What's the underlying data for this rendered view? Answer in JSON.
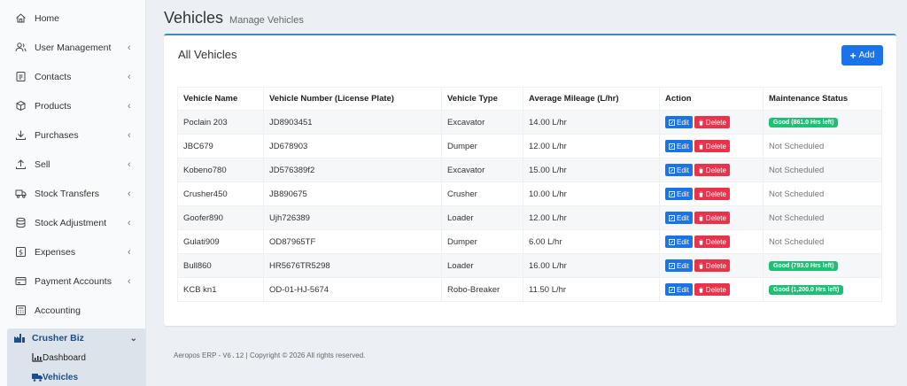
{
  "sidebar": {
    "items": [
      {
        "label": "Home",
        "icon": "home-icon",
        "chevron": false
      },
      {
        "label": "User Management",
        "icon": "users-icon",
        "chevron": true
      },
      {
        "label": "Contacts",
        "icon": "contacts-icon",
        "chevron": true
      },
      {
        "label": "Products",
        "icon": "box-icon",
        "chevron": true
      },
      {
        "label": "Purchases",
        "icon": "download-icon",
        "chevron": true
      },
      {
        "label": "Sell",
        "icon": "upload-icon",
        "chevron": true
      },
      {
        "label": "Stock Transfers",
        "icon": "truck-icon",
        "chevron": true
      },
      {
        "label": "Stock Adjustment",
        "icon": "database-icon",
        "chevron": true
      },
      {
        "label": "Expenses",
        "icon": "dollar-icon",
        "chevron": true
      },
      {
        "label": "Payment Accounts",
        "icon": "card-icon",
        "chevron": true
      },
      {
        "label": "Accounting",
        "icon": "calculator-icon",
        "chevron": false
      }
    ],
    "group": {
      "label": "Crusher Biz",
      "subitems": [
        "Dashboard",
        "Vehicles"
      ]
    }
  },
  "header": {
    "title": "Vehicles",
    "subtitle": "Manage Vehicles"
  },
  "card": {
    "title": "All Vehicles",
    "add_label": "Add"
  },
  "table": {
    "columns": [
      "Vehicle Name",
      "Vehicle Number (License Plate)",
      "Vehicle Type",
      "Average Mileage (L/hr)",
      "Action",
      "Maintenance Status"
    ],
    "edit_label": "Edit",
    "delete_label": "Delete",
    "rows": [
      {
        "name": "Poclain 203",
        "number": "JD8903451",
        "type": "Excavator",
        "mileage": "14.00 L/hr",
        "status": "Good (861.0 Hrs left)",
        "good": true
      },
      {
        "name": "JBC679",
        "number": "JD678903",
        "type": "Dumper",
        "mileage": "12.00 L/hr",
        "status": "Not Scheduled",
        "good": false
      },
      {
        "name": "Kobeno780",
        "number": "JD576389f2",
        "type": "Excavator",
        "mileage": "15.00 L/hr",
        "status": "Not Scheduled",
        "good": false
      },
      {
        "name": "Crusher450",
        "number": "JB890675",
        "type": "Crusher",
        "mileage": "10.00 L/hr",
        "status": "Not Scheduled",
        "good": false
      },
      {
        "name": "Goofer890",
        "number": "Ujh726389",
        "type": "Loader",
        "mileage": "12.00 L/hr",
        "status": "Not Scheduled",
        "good": false
      },
      {
        "name": "Gulati909",
        "number": "OD87965TF",
        "type": "Dumper",
        "mileage": "6.00 L/hr",
        "status": "Not Scheduled",
        "good": false
      },
      {
        "name": "Bull860",
        "number": "HR5676TR5298",
        "type": "Loader",
        "mileage": "16.00 L/hr",
        "status": "Good (793.0 Hrs left)",
        "good": true
      },
      {
        "name": "KCB kn1",
        "number": "OD-01-HJ-5674",
        "type": "Robo-Breaker",
        "mileage": "11.50 L/hr",
        "status": "Good (1,200.0 Hrs left)",
        "good": true
      }
    ]
  },
  "footer": {
    "prefix": "Aeropos ERP - ",
    "version": "V6.12",
    "suffix": " | Copyright © 2026 All rights reserved."
  },
  "colors": {
    "primary": "#1a73e8",
    "danger": "#e8334a",
    "success": "#1fbf75",
    "brand": "#1a4f8b"
  }
}
